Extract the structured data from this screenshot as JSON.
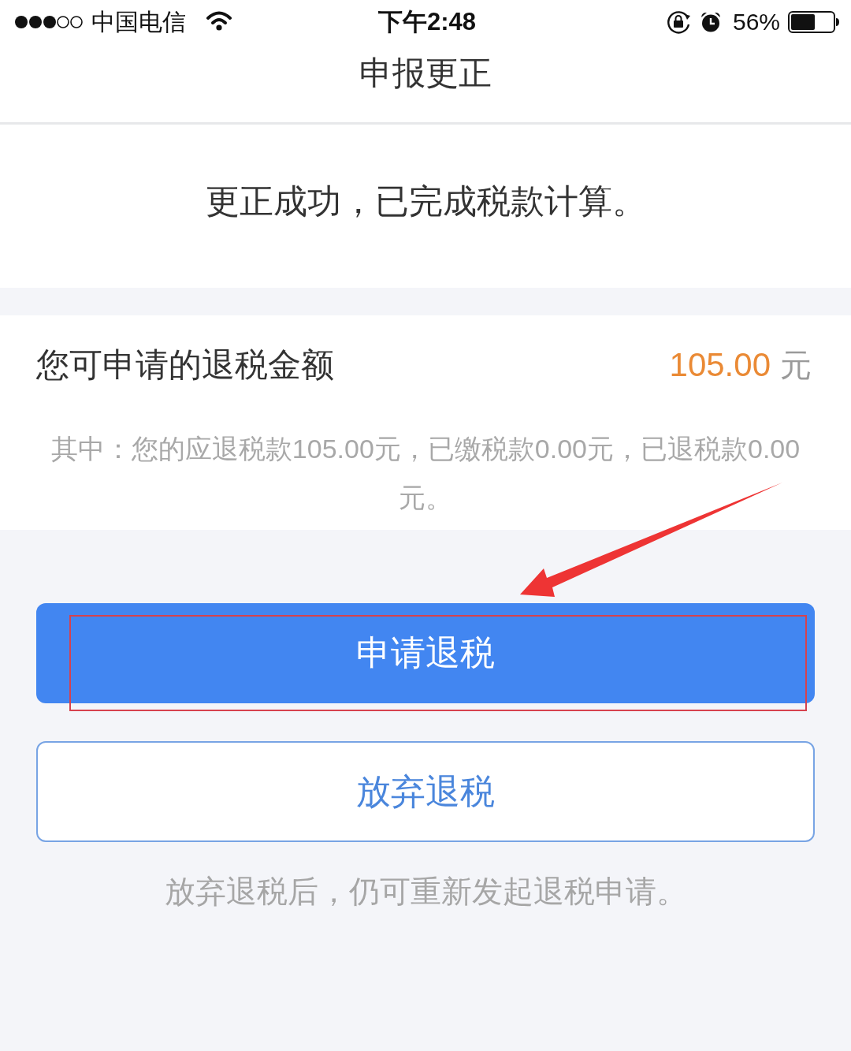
{
  "status_bar": {
    "carrier": "中国电信",
    "time": "下午2:48",
    "battery_percent": "56%"
  },
  "nav": {
    "title": "申报更正"
  },
  "result": {
    "message": "更正成功，已完成税款计算。"
  },
  "refund": {
    "label": "您可申请的退税金额",
    "amount": "105.00",
    "unit": "元",
    "detail": "其中：您的应退税款105.00元，已缴税款0.00元，已退税款0.00元。"
  },
  "buttons": [
    {
      "label": "申请退税",
      "kind": "primary"
    },
    {
      "label": "放弃退税",
      "kind": "secondary"
    }
  ],
  "hint": "放弃退税后，仍可重新发起退税申请。"
}
